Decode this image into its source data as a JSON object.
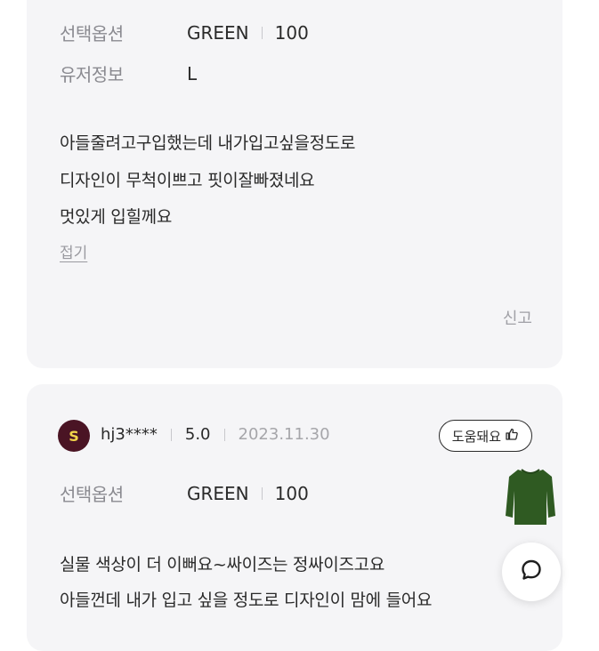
{
  "review1": {
    "option_label": "선택옵션",
    "option_color": "GREEN",
    "option_size": "100",
    "userinfo_label": "유저정보",
    "userinfo_value": "L",
    "lines": [
      "아들줄려고구입했는데 내가입고싶을정도로",
      "디자인이 무척이쁘고 핏이잘빠졌네요",
      "멋있게 입힐께요"
    ],
    "fold": "접기",
    "report": "신고"
  },
  "review2": {
    "avatar_letter": "S",
    "username": "hj3****",
    "score": "5.0",
    "date": "2023.11.30",
    "helpful": "도움돼요",
    "option_label": "선택옵션",
    "option_color": "GREEN",
    "option_size": "100",
    "lines": [
      "실물 색상이 더 이뻐요~싸이즈는 정싸이즈고요",
      "아들껀데 내가 입고 싶을 정도로 디자인이 맘에 들어요"
    ]
  },
  "colors": {
    "card_bg": "#f5f5f7",
    "avatar_bg": "#4a1424",
    "avatar_fg": "#f1d54a",
    "sweater": "#2f5a22"
  },
  "icons": {
    "helpful": "thumbs-up-icon",
    "chat": "chat-bubble-icon"
  }
}
